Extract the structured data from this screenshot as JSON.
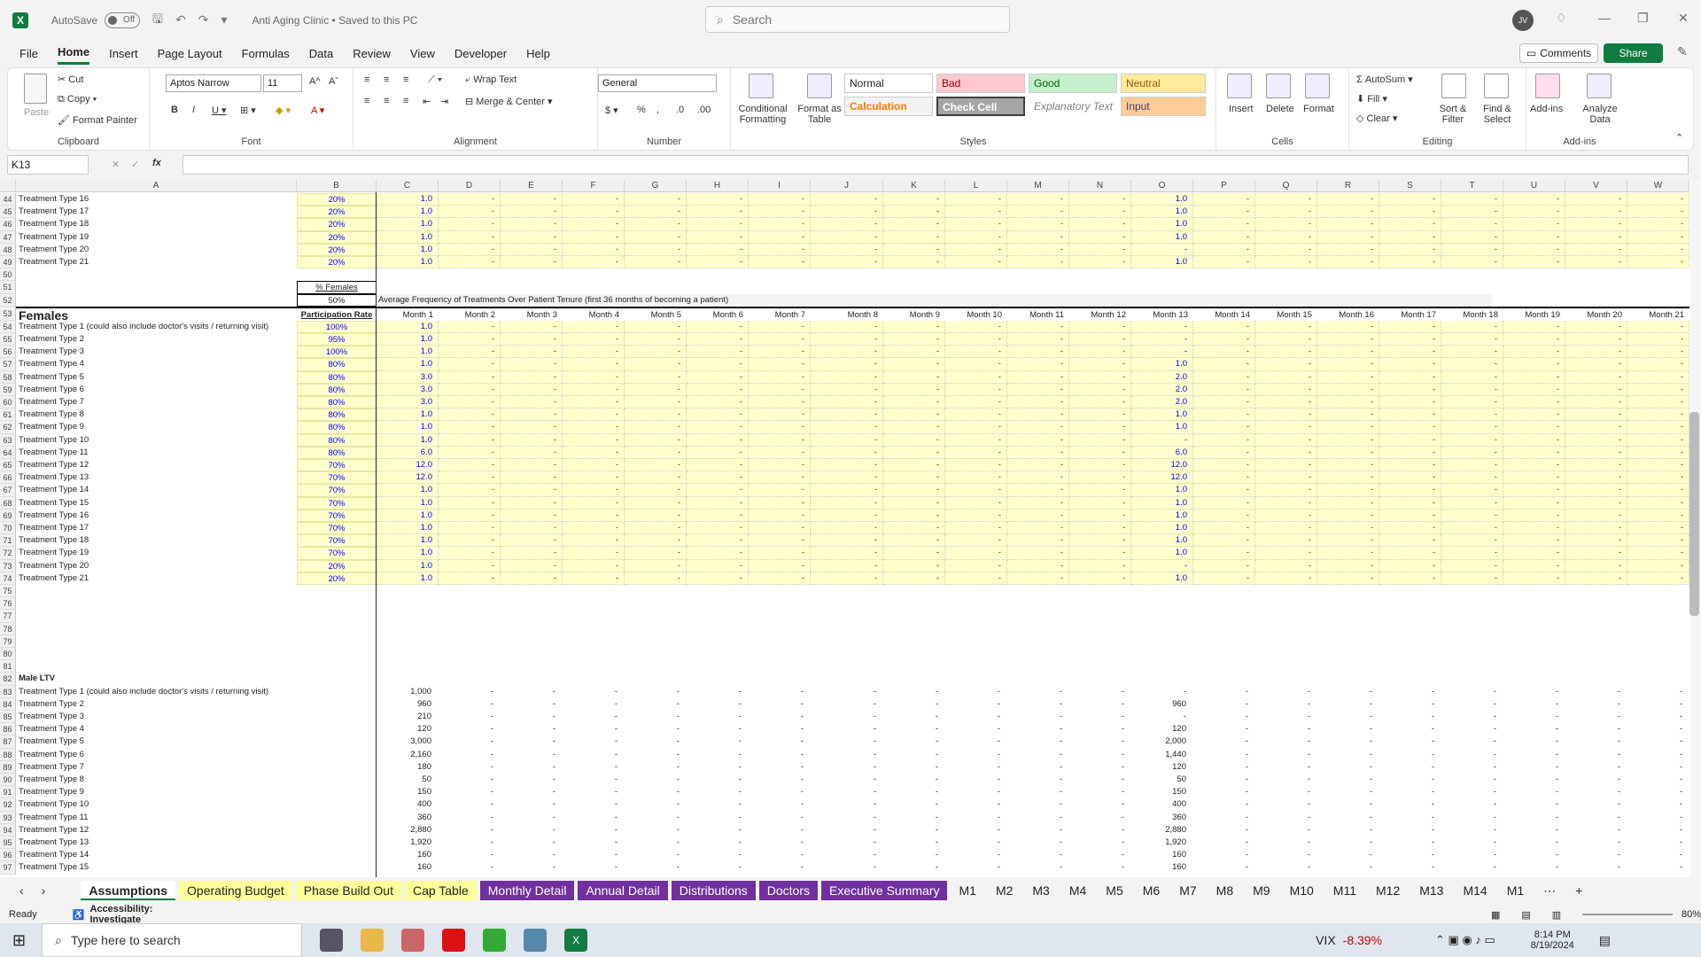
{
  "titlebar": {
    "autosave_label": "AutoSave",
    "autosave_state": "Off",
    "doc_title": "Anti Aging Clinic • Saved to this PC",
    "search_placeholder": "Search",
    "user_initials": "JV"
  },
  "menu": [
    "File",
    "Home",
    "Insert",
    "Page Layout",
    "Formulas",
    "Data",
    "Review",
    "View",
    "Developer",
    "Help"
  ],
  "active_menu": "Home",
  "comments_label": "Comments",
  "share_label": "Share",
  "ribbon": {
    "clipboard": {
      "paste": "Paste",
      "cut": "Cut",
      "copy": "Copy",
      "format_painter": "Format Painter",
      "label": "Clipboard"
    },
    "font": {
      "name": "Aptos Narrow",
      "size": "11",
      "label": "Font"
    },
    "alignment": {
      "wrap": "Wrap Text",
      "merge": "Merge & Center",
      "label": "Alignment"
    },
    "number": {
      "format": "General",
      "label": "Number"
    },
    "styles": {
      "conditional": "Conditional Formatting",
      "format_table": "Format as Table",
      "cells": [
        {
          "name": "Normal",
          "bg": "#ffffff",
          "fg": "#000000"
        },
        {
          "name": "Bad",
          "bg": "#ffc7ce",
          "fg": "#9c0006"
        },
        {
          "name": "Good",
          "bg": "#c6efce",
          "fg": "#006100"
        },
        {
          "name": "Neutral",
          "bg": "#ffeb9c",
          "fg": "#9c5700"
        },
        {
          "name": "Calculation",
          "bg": "#f2f2f2",
          "fg": "#fa7d00"
        },
        {
          "name": "Check Cell",
          "bg": "#a5a5a5",
          "fg": "#ffffff"
        },
        {
          "name": "Explanatory Text",
          "bg": "#ffffff",
          "fg": "#7f7f7f"
        },
        {
          "name": "Input",
          "bg": "#ffcc99",
          "fg": "#3f3f76"
        }
      ],
      "label": "Styles"
    },
    "cells": {
      "insert": "Insert",
      "delete": "Delete",
      "format": "Format",
      "label": "Cells"
    },
    "editing": {
      "autosum": "AutoSum",
      "fill": "Fill",
      "clear": "Clear",
      "sort": "Sort & Filter",
      "find": "Find & Select",
      "label": "Editing"
    },
    "addins": {
      "addins": "Add-ins",
      "analyze": "Analyze Data",
      "label": "Add-ins"
    }
  },
  "namebox": "K13",
  "columns": [
    "A",
    "B",
    "C",
    "D",
    "E",
    "F",
    "G",
    "H",
    "I",
    "J",
    "K",
    "L",
    "M",
    "N",
    "O",
    "P",
    "Q",
    "R",
    "S",
    "T",
    "U",
    "V",
    "W"
  ],
  "females_header": {
    "pct_label": "% Females",
    "pct_value": "50%",
    "freq_note": "Average Frequency of Treatments Over Patient Tenure (first 36 months of becoming a patient)",
    "section_title": "Females",
    "participation": "Participation Rate",
    "months": [
      "Month 1",
      "Month 2",
      "Month 3",
      "Month 4",
      "Month 5",
      "Month 6",
      "Month 7",
      "Month 8",
      "Month 9",
      "Month 10",
      "Month 11",
      "Month 12",
      "Month 13",
      "Month 14",
      "Month 15",
      "Month 16",
      "Month 17",
      "Month 18",
      "Month 19",
      "Month 20",
      "Month 21"
    ]
  },
  "top_rows": [
    {
      "row": "44",
      "name": "Treatment Type 16",
      "rate": "20%",
      "c": "1.0",
      "o": "1.0"
    },
    {
      "row": "45",
      "name": "Treatment Type 17",
      "rate": "20%",
      "c": "1.0",
      "o": "1.0"
    },
    {
      "row": "46",
      "name": "Treatment Type 18",
      "rate": "20%",
      "c": "1.0",
      "o": "1.0"
    },
    {
      "row": "47",
      "name": "Treatment Type 19",
      "rate": "20%",
      "c": "1.0",
      "o": "1.0"
    },
    {
      "row": "48",
      "name": "Treatment Type 20",
      "rate": "20%",
      "c": "1.0",
      "o": "-"
    },
    {
      "row": "49",
      "name": "Treatment Type 21",
      "rate": "20%",
      "c": "1.0",
      "o": "1.0"
    }
  ],
  "female_rows": [
    {
      "row": "54",
      "name": "Treatment Type 1 (could also include doctor's visits / returning visit)",
      "rate": "100%",
      "c": "1.0",
      "o": "-"
    },
    {
      "row": "55",
      "name": "Treatment Type 2",
      "rate": "95%",
      "c": "1.0",
      "o": "-"
    },
    {
      "row": "56",
      "name": "Treatment Type 3",
      "rate": "100%",
      "c": "1.0",
      "o": "-"
    },
    {
      "row": "57",
      "name": "Treatment Type 4",
      "rate": "80%",
      "c": "1.0",
      "o": "1.0"
    },
    {
      "row": "58",
      "name": "Treatment Type 5",
      "rate": "80%",
      "c": "3.0",
      "o": "2.0"
    },
    {
      "row": "59",
      "name": "Treatment Type 6",
      "rate": "80%",
      "c": "3.0",
      "o": "2.0"
    },
    {
      "row": "60",
      "name": "Treatment Type 7",
      "rate": "80%",
      "c": "3.0",
      "o": "2.0"
    },
    {
      "row": "61",
      "name": "Treatment Type 8",
      "rate": "80%",
      "c": "1.0",
      "o": "1.0"
    },
    {
      "row": "62",
      "name": "Treatment Type 9",
      "rate": "80%",
      "c": "1.0",
      "o": "1.0"
    },
    {
      "row": "63",
      "name": "Treatment Type 10",
      "rate": "80%",
      "c": "1.0",
      "o": "-"
    },
    {
      "row": "64",
      "name": "Treatment Type 11",
      "rate": "80%",
      "c": "6.0",
      "o": "6.0"
    },
    {
      "row": "65",
      "name": "Treatment Type 12",
      "rate": "70%",
      "c": "12.0",
      "o": "12.0"
    },
    {
      "row": "66",
      "name": "Treatment Type 13",
      "rate": "70%",
      "c": "12.0",
      "o": "12.0"
    },
    {
      "row": "67",
      "name": "Treatment Type 14",
      "rate": "70%",
      "c": "1.0",
      "o": "1.0"
    },
    {
      "row": "68",
      "name": "Treatment Type 15",
      "rate": "70%",
      "c": "1.0",
      "o": "1.0"
    },
    {
      "row": "69",
      "name": "Treatment Type 16",
      "rate": "70%",
      "c": "1.0",
      "o": "1.0"
    },
    {
      "row": "70",
      "name": "Treatment Type 17",
      "rate": "70%",
      "c": "1.0",
      "o": "1.0"
    },
    {
      "row": "71",
      "name": "Treatment Type 18",
      "rate": "70%",
      "c": "1.0",
      "o": "1.0"
    },
    {
      "row": "72",
      "name": "Treatment Type 19",
      "rate": "70%",
      "c": "1.0",
      "o": "1.0"
    },
    {
      "row": "73",
      "name": "Treatment Type 20",
      "rate": "20%",
      "c": "1.0",
      "o": "-"
    },
    {
      "row": "74",
      "name": "Treatment Type 21",
      "rate": "20%",
      "c": "1.0",
      "o": "1.0"
    }
  ],
  "empty_rows": [
    "50",
    "75",
    "76",
    "77",
    "78",
    "79",
    "80",
    "81"
  ],
  "male_ltv_title": "Male LTV",
  "male_ltv_title_row": "82",
  "male_rows": [
    {
      "row": "83",
      "name": "Treatment Type 1 (could also include doctor's visits / returning visit)",
      "c": "1,000",
      "o": "-"
    },
    {
      "row": "84",
      "name": "Treatment Type 2",
      "c": "960",
      "o": "960"
    },
    {
      "row": "85",
      "name": "Treatment Type 3",
      "c": "210",
      "o": "-"
    },
    {
      "row": "86",
      "name": "Treatment Type 4",
      "c": "120",
      "o": "120"
    },
    {
      "row": "87",
      "name": "Treatment Type 5",
      "c": "3,000",
      "o": "2,000"
    },
    {
      "row": "88",
      "name": "Treatment Type 6",
      "c": "2,160",
      "o": "1,440"
    },
    {
      "row": "89",
      "name": "Treatment Type 7",
      "c": "180",
      "o": "120"
    },
    {
      "row": "90",
      "name": "Treatment Type 8",
      "c": "50",
      "o": "50"
    },
    {
      "row": "91",
      "name": "Treatment Type 9",
      "c": "150",
      "o": "150"
    },
    {
      "row": "92",
      "name": "Treatment Type 10",
      "c": "400",
      "o": "400"
    },
    {
      "row": "93",
      "name": "Treatment Type 11",
      "c": "360",
      "o": "360"
    },
    {
      "row": "94",
      "name": "Treatment Type 12",
      "c": "2,880",
      "o": "2,880"
    },
    {
      "row": "95",
      "name": "Treatment Type 13",
      "c": "1,920",
      "o": "1,920"
    },
    {
      "row": "96",
      "name": "Treatment Type 14",
      "c": "160",
      "o": "160"
    },
    {
      "row": "97",
      "name": "Treatment Type 15",
      "c": "160",
      "o": "160"
    }
  ],
  "dash": "-",
  "sheet_tabs": [
    {
      "name": "Assumptions",
      "style": "active"
    },
    {
      "name": "Operating Budget",
      "style": "yellow"
    },
    {
      "name": "Phase Build Out",
      "style": "yellow"
    },
    {
      "name": "Cap Table",
      "style": "yellow"
    },
    {
      "name": "Monthly Detail",
      "style": "purple"
    },
    {
      "name": "Annual Detail",
      "style": "purple"
    },
    {
      "name": "Distributions",
      "style": "purple"
    },
    {
      "name": "Doctors",
      "style": "purple"
    },
    {
      "name": "Executive Summary",
      "style": "purple"
    },
    {
      "name": "M1",
      "style": "plain"
    },
    {
      "name": "M2",
      "style": "plain"
    },
    {
      "name": "M3",
      "style": "plain"
    },
    {
      "name": "M4",
      "style": "plain"
    },
    {
      "name": "M5",
      "style": "plain"
    },
    {
      "name": "M6",
      "style": "plain"
    },
    {
      "name": "M7",
      "style": "plain"
    },
    {
      "name": "M8",
      "style": "plain"
    },
    {
      "name": "M9",
      "style": "plain"
    },
    {
      "name": "M10",
      "style": "plain"
    },
    {
      "name": "M11",
      "style": "plain"
    },
    {
      "name": "M12",
      "style": "plain"
    },
    {
      "name": "M13",
      "style": "plain"
    },
    {
      "name": "M14",
      "style": "plain"
    },
    {
      "name": "M1",
      "style": "plain"
    }
  ],
  "status": {
    "ready": "Ready",
    "accessibility": "Accessibility: Investigate",
    "zoom": "80%"
  },
  "taskbar": {
    "search": "Type here to search",
    "vix": "VIX",
    "vix_change": "-8.39%",
    "time": "8:14 PM",
    "date": "8/19/2024"
  },
  "colors": {
    "excel_green": "#107c41",
    "input_yellow": "#ffffcc",
    "blue_value": "#0000ff",
    "purple_tab": "#7030a0",
    "yellow_tab": "#ffff99"
  }
}
